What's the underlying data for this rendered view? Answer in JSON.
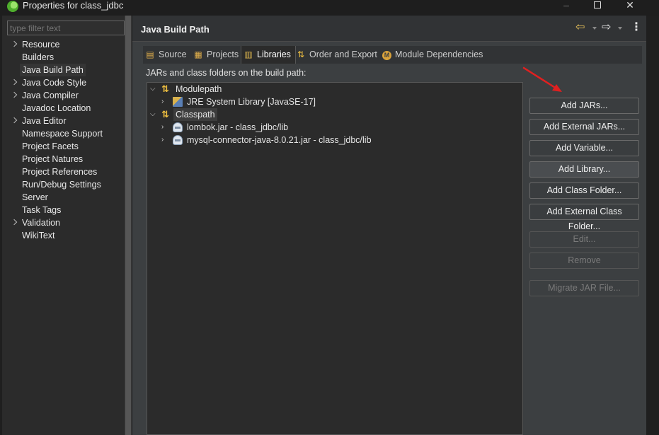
{
  "window": {
    "title": "Properties for class_jdbc",
    "icon": "spring-icon",
    "controls": {
      "minimize": "–",
      "close": "✕"
    }
  },
  "sidebar": {
    "filter_placeholder": "type filter text",
    "items": [
      {
        "label": "Resource",
        "expandable": true
      },
      {
        "label": "Builders",
        "expandable": false
      },
      {
        "label": "Java Build Path",
        "expandable": false,
        "selected": true
      },
      {
        "label": "Java Code Style",
        "expandable": true
      },
      {
        "label": "Java Compiler",
        "expandable": true
      },
      {
        "label": "Javadoc Location",
        "expandable": false
      },
      {
        "label": "Java Editor",
        "expandable": true
      },
      {
        "label": "Namespace Support",
        "expandable": false
      },
      {
        "label": "Project Facets",
        "expandable": false
      },
      {
        "label": "Project Natures",
        "expandable": false
      },
      {
        "label": "Project References",
        "expandable": false
      },
      {
        "label": "Run/Debug Settings",
        "expandable": false
      },
      {
        "label": "Server",
        "expandable": false
      },
      {
        "label": "Task Tags",
        "expandable": false
      },
      {
        "label": "Validation",
        "expandable": true
      },
      {
        "label": "WikiText",
        "expandable": false
      }
    ]
  },
  "page": {
    "title": "Java Build Path",
    "nav_icons": {
      "back": "⇦",
      "forward": "⇨",
      "menu": "⋮"
    }
  },
  "tabs": [
    {
      "label": "Source",
      "icon": "source-folder-icon",
      "glyph": "▤"
    },
    {
      "label": "Projects",
      "icon": "projects-icon",
      "glyph": "▦"
    },
    {
      "label": "Libraries",
      "icon": "libraries-icon",
      "glyph": "▥",
      "active": true
    },
    {
      "label": "Order and Export",
      "icon": "order-export-icon",
      "glyph": "⇅"
    },
    {
      "label": "Module Dependencies",
      "icon": "module-icon",
      "glyph": "M"
    }
  ],
  "libraries": {
    "label": "JARs and class folders on the build path:",
    "tree": [
      {
        "label": "Modulepath",
        "expanded": true,
        "icon": "path-icon"
      },
      {
        "label": "JRE System Library [JavaSE-17]",
        "expanded": false,
        "icon": "library-icon"
      },
      {
        "label": "Classpath",
        "expanded": true,
        "icon": "path-icon",
        "selected": true
      },
      {
        "label": "lombok.jar - class_jdbc/lib",
        "expanded": false,
        "icon": "jar-icon"
      },
      {
        "label": "mysql-connector-java-8.0.21.jar - class_jdbc/lib",
        "expanded": false,
        "icon": "jar-icon"
      }
    ],
    "buttons": {
      "add_jars": "Add JARs...",
      "add_external_jars": "Add External JARs...",
      "add_variable": "Add Variable...",
      "add_library": "Add Library...",
      "add_class_folder": "Add Class Folder...",
      "add_external_class_folder": "Add External Class Folder...",
      "edit": "Edit...",
      "remove": "Remove",
      "migrate_jar": "Migrate JAR File..."
    }
  },
  "colors": {
    "background": "#3c3f41",
    "tree_background": "#2b2b2b",
    "annotation_arrow": "#e02020"
  }
}
